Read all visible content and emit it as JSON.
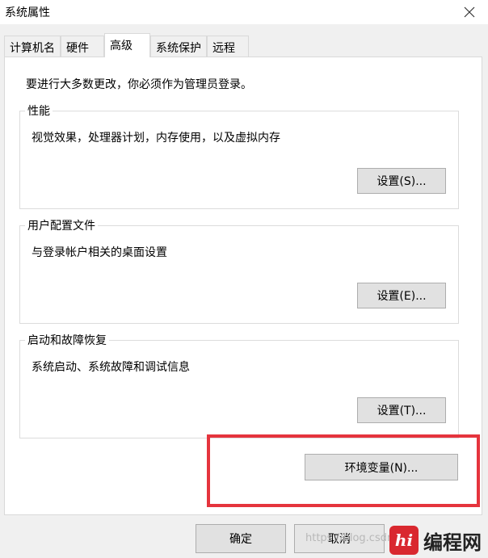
{
  "window": {
    "title": "系统属性",
    "close_icon": "close-icon"
  },
  "tabs": [
    {
      "label": "计算机名",
      "active": false
    },
    {
      "label": "硬件",
      "active": false
    },
    {
      "label": "高级",
      "active": true
    },
    {
      "label": "系统保护",
      "active": false
    },
    {
      "label": "远程",
      "active": false
    }
  ],
  "main": {
    "notice": "要进行大多数更改，你必须作为管理员登录。",
    "groups": [
      {
        "title": "性能",
        "description": "视觉效果，处理器计划，内存使用，以及虚拟内存",
        "button": "设置(S)..."
      },
      {
        "title": "用户配置文件",
        "description": "与登录帐户相关的桌面设置",
        "button": "设置(E)..."
      },
      {
        "title": "启动和故障恢复",
        "description": "系统启动、系统故障和调试信息",
        "button": "设置(T)..."
      }
    ],
    "env_button": "环境变量(N)..."
  },
  "footer": {
    "ok_label": "确定",
    "cancel_label": "取消"
  },
  "overlay": {
    "highlight_color": "#e5343d",
    "watermark": "https://blog.csdn.n",
    "logo_mark": "hi",
    "logo_text": "编程网"
  }
}
